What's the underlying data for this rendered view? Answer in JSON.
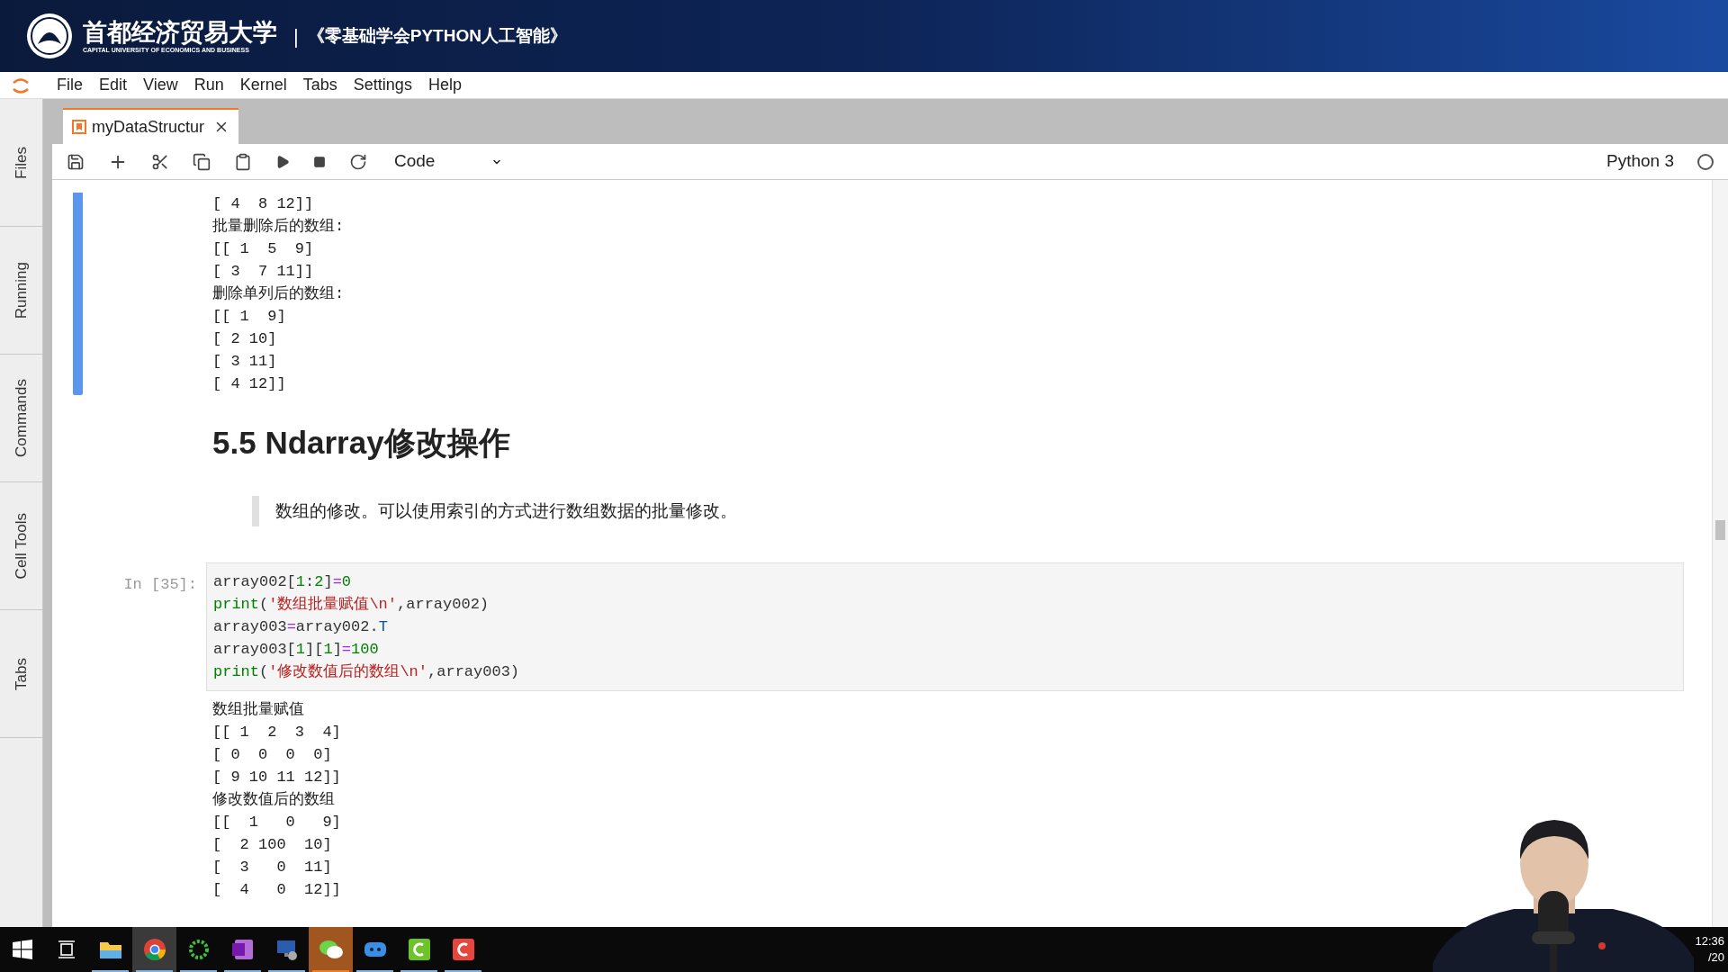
{
  "banner": {
    "university": "首都经济贸易大学",
    "university_en": "CAPITAL UNIVERSITY OF ECONOMICS AND BUSINESS",
    "separator": "|",
    "course": "《零基础学会PYTHON人工智能》"
  },
  "menu": [
    "File",
    "Edit",
    "View",
    "Run",
    "Kernel",
    "Tabs",
    "Settings",
    "Help"
  ],
  "sidebar": [
    "Files",
    "Running",
    "Commands",
    "Cell Tools",
    "Tabs"
  ],
  "tabs": [
    {
      "label": "myDataStructur",
      "selected": true
    }
  ],
  "toolbar": {
    "cell_type": "Code",
    "kernel": "Python 3"
  },
  "cells": [
    {
      "kind": "output",
      "active": true,
      "lines": [
        "[ 4  8 12]]",
        "批量删除后的数组:",
        "[[ 1  5  9]",
        "[ 3  7 11]]",
        "删除单列后的数组:",
        "[[ 1  9]",
        "[ 2 10]",
        "[ 3 11]",
        "[ 4 12]]"
      ]
    },
    {
      "kind": "heading",
      "text": "5.5 Ndarray修改操作"
    },
    {
      "kind": "quote",
      "text": "数组的修改。可以使用索引的方式进行数组数据的批量修改。"
    },
    {
      "kind": "code",
      "active": false,
      "prompt": "In [35]:",
      "code": [
        [
          {
            "t": "array002[",
            "kind": "name"
          },
          {
            "t": "1",
            "kind": "num"
          },
          {
            "t": ":",
            "kind": "name"
          },
          {
            "t": "2",
            "kind": "num"
          },
          {
            "t": "]",
            "kind": "name"
          },
          {
            "t": "=",
            "kind": "op"
          },
          {
            "t": "0",
            "kind": "num"
          }
        ],
        [
          {
            "t": "print",
            "kind": "builtin"
          },
          {
            "t": "(",
            "kind": "name"
          },
          {
            "t": "'数组批量赋值\\n'",
            "kind": "str"
          },
          {
            "t": ",array002)",
            "kind": "name"
          }
        ],
        [
          {
            "t": "array003",
            "kind": "name"
          },
          {
            "t": "=",
            "kind": "op"
          },
          {
            "t": "array002.",
            "kind": "name"
          },
          {
            "t": "T",
            "kind": "attr"
          }
        ],
        [
          {
            "t": "array003[",
            "kind": "name"
          },
          {
            "t": "1",
            "kind": "num"
          },
          {
            "t": "][",
            "kind": "name"
          },
          {
            "t": "1",
            "kind": "num"
          },
          {
            "t": "]",
            "kind": "name"
          },
          {
            "t": "=",
            "kind": "op"
          },
          {
            "t": "100",
            "kind": "num"
          }
        ],
        [
          {
            "t": "print",
            "kind": "builtin"
          },
          {
            "t": "(",
            "kind": "name"
          },
          {
            "t": "'修改数值后的数组\\n'",
            "kind": "str"
          },
          {
            "t": ",array003)",
            "kind": "name"
          }
        ]
      ],
      "output": [
        "数组批量赋值",
        "[[ 1  2  3  4]",
        "[ 0  0  0  0]",
        "[ 9 10 11 12]]",
        "修改数值后的数组",
        "[[  1   0   9]",
        "[  2 100  10]",
        "[  3   0  11]",
        "[  4   0  12]]"
      ]
    }
  ],
  "taskbar": {
    "apps": [
      {
        "kind": "start",
        "running": false,
        "highlighted": false,
        "alert": false
      },
      {
        "kind": "taskview",
        "running": false,
        "highlighted": false,
        "alert": false
      },
      {
        "kind": "folder",
        "running": true,
        "highlighted": false,
        "alert": false
      },
      {
        "kind": "browser",
        "running": true,
        "highlighted": true,
        "alert": false
      },
      {
        "kind": "ring",
        "running": true,
        "highlighted": false,
        "alert": false
      },
      {
        "kind": "notebook",
        "running": true,
        "highlighted": false,
        "alert": false
      },
      {
        "kind": "remote",
        "running": true,
        "highlighted": false,
        "alert": false
      },
      {
        "kind": "chat",
        "running": true,
        "highlighted": false,
        "alert": true
      },
      {
        "kind": "game",
        "running": true,
        "highlighted": false,
        "alert": false
      },
      {
        "kind": "recorder",
        "running": true,
        "highlighted": false,
        "alert": false
      },
      {
        "kind": "editor",
        "running": true,
        "highlighted": false,
        "alert": false
      }
    ],
    "clock": "12:36",
    "date": "/20"
  }
}
